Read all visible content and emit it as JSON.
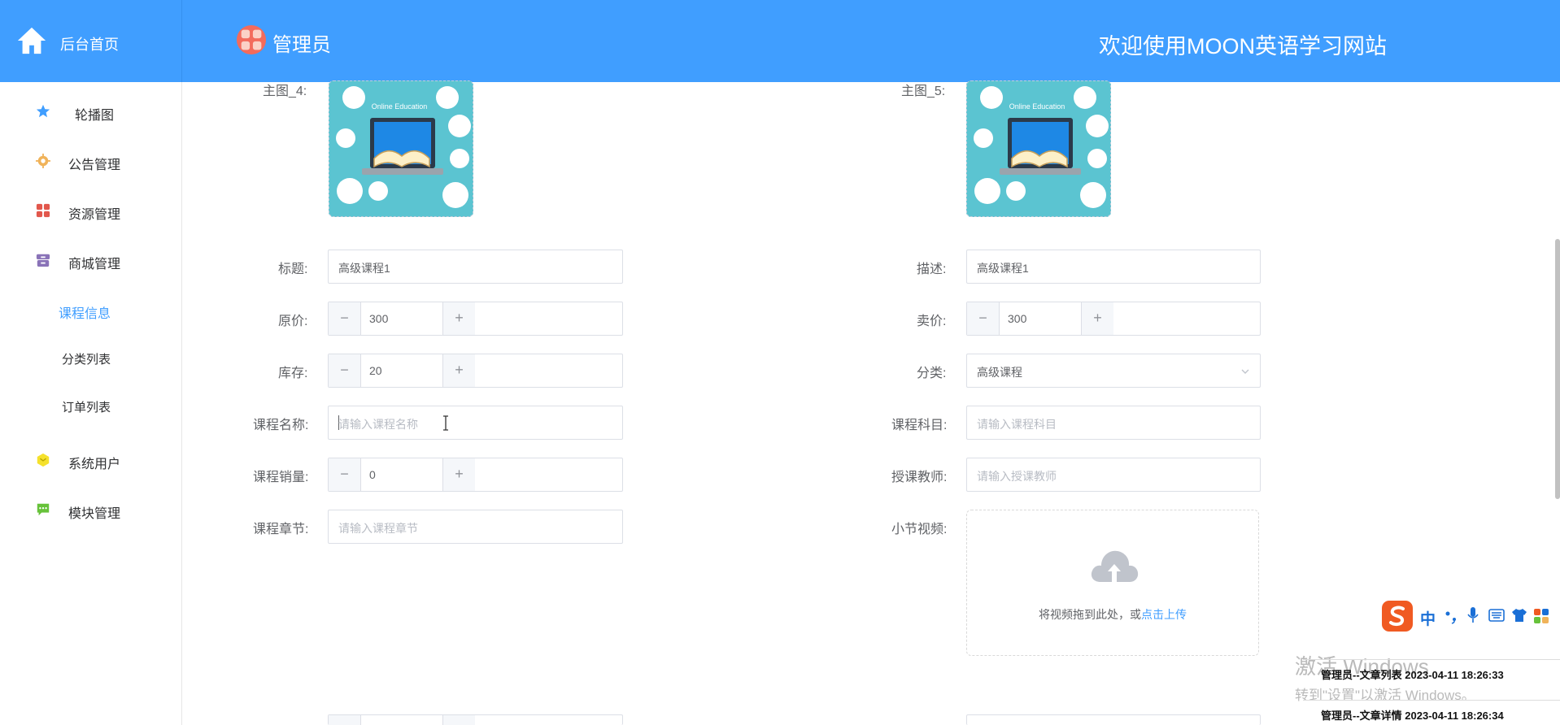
{
  "header": {
    "home_label": "后台首页",
    "role": "管理员",
    "welcome": "欢迎使用MOON英语学习网站"
  },
  "sidebar": {
    "items": [
      {
        "label": "轮播图",
        "icon": "star-icon"
      },
      {
        "label": "公告管理",
        "icon": "gear-icon"
      },
      {
        "label": "资源管理",
        "icon": "grid-icon"
      },
      {
        "label": "商城管理",
        "icon": "box-icon"
      }
    ],
    "sub_items": [
      {
        "label": "课程信息",
        "active": true
      },
      {
        "label": "分类列表"
      },
      {
        "label": "订单列表"
      }
    ],
    "bottom_items": [
      {
        "label": "系统用户",
        "icon": "user-icon"
      },
      {
        "label": "模块管理",
        "icon": "chat-icon"
      }
    ]
  },
  "form": {
    "image4_label": "主图_4:",
    "image5_label": "主图_5:",
    "image_caption": "Online Education",
    "title_label": "标题:",
    "title_value": "高级课程1",
    "desc_label": "描述:",
    "desc_value": "高级课程1",
    "orig_price_label": "原价:",
    "orig_price_value": "300",
    "sale_price_label": "卖价:",
    "sale_price_value": "300",
    "stock_label": "库存:",
    "stock_value": "20",
    "category_label": "分类:",
    "category_value": "高级课程",
    "course_name_label": "课程名称:",
    "course_name_placeholder": "请输入课程名称",
    "course_subject_label": "课程科目:",
    "course_subject_placeholder": "请输入课程科目",
    "sales_label": "课程销量:",
    "sales_value": "0",
    "teacher_label": "授课教师:",
    "teacher_placeholder": "请输入授课教师",
    "chapter_label": "课程章节:",
    "chapter_placeholder": "请输入课程章节",
    "video_label": "小节视频:",
    "upload_text": "将视频拖到此处，或",
    "upload_link": "点击上传"
  },
  "overlay": {
    "activation_title": "激活 Windows",
    "activation_sub": "转到\"设置\"以激活 Windows。",
    "log1": "管理员--文章列表 2023-04-11 18:26:33",
    "log2": "管理员--文章详情 2023-04-11 18:26:34",
    "ime_text": "中"
  },
  "colors": {
    "header": "#409eff",
    "active": "#409eff"
  }
}
